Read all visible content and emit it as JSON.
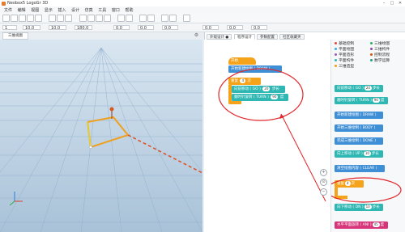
{
  "window": {
    "title": "Neobox5 LogoGr 3D",
    "min": "–",
    "max": "□",
    "close": "✕"
  },
  "menu": [
    "文件",
    "编辑",
    "视图",
    "显示",
    "插入",
    "设计",
    "仿真",
    "工具",
    "窗口",
    "帮助"
  ],
  "toolbar": {
    "fields": [
      "1",
      "10.0",
      "10.0",
      "180.0",
      "0.0",
      "0.0",
      "0.0",
      "0.0",
      "0.0",
      "0.0"
    ]
  },
  "viewport": {
    "tab_label": "三维视图"
  },
  "tabs": [
    {
      "label": "外观设计 ●"
    },
    {
      "label": "程序设计"
    },
    {
      "label": "参数配置"
    },
    {
      "label": "社区收藏夹"
    }
  ],
  "workspace": {
    "start_block": "开始",
    "draw_block": "开始新建绘图 ( DRAW )",
    "repeat_block": "重复",
    "repeat_count": "4",
    "repeat_suffix": "次",
    "fd_block": "向前移动 ( GO )",
    "fd_value": "20",
    "fd_unit": "步长",
    "rt_block": "顺时针旋转 ( TURN )",
    "rt_value": "90",
    "rt_unit": "度"
  },
  "categories": [
    {
      "label": "基础控制",
      "color": "#e0493b"
    },
    {
      "label": "平面绘图",
      "color": "#3aa9e0"
    },
    {
      "label": "平面造形",
      "color": "#9b59b6"
    },
    {
      "label": "平面构件",
      "color": "#2fb7b3"
    },
    {
      "label": "三维造型",
      "color": "#f39c12"
    },
    {
      "label": "三维绘图",
      "color": "#27ae60"
    },
    {
      "label": "三维构件",
      "color": "#8e44ad"
    },
    {
      "label": "控制流程",
      "color": "#d35400"
    },
    {
      "label": "数学运算",
      "color": "#16a085"
    }
  ],
  "palette_blocks": [
    {
      "label": "向前移动 ( GO )",
      "value": "20",
      "unit": "步长",
      "color": "teal"
    },
    {
      "label": "顺时针旋转 ( TURN )",
      "value": "90",
      "unit": "度",
      "color": "teal"
    },
    {
      "label": "开始新建绘图 ( DRAW )",
      "color": "blue"
    },
    {
      "label": "开始三维绘制 ( BODY )",
      "color": "blue"
    },
    {
      "label": "完成三维绘制 ( DONE )",
      "color": "blue"
    },
    {
      "label": "向上移动 ( UP )",
      "value": "10",
      "unit": "步长",
      "color": "teal"
    },
    {
      "label": "清空绘图内容 ( CLEAR )",
      "color": "blue"
    },
    {
      "label": "重复",
      "value": "4",
      "unit": "次",
      "color": "orange"
    },
    {
      "label": "向下移动 ( DN )",
      "value": "10",
      "unit": "步长",
      "color": "teal"
    },
    {
      "label": "水平平面旋转 ( ANI )",
      "value": "45",
      "unit": "度",
      "color": "magenta"
    }
  ],
  "zoom": {
    "in": "+",
    "reset": "⊙",
    "out": "−"
  }
}
